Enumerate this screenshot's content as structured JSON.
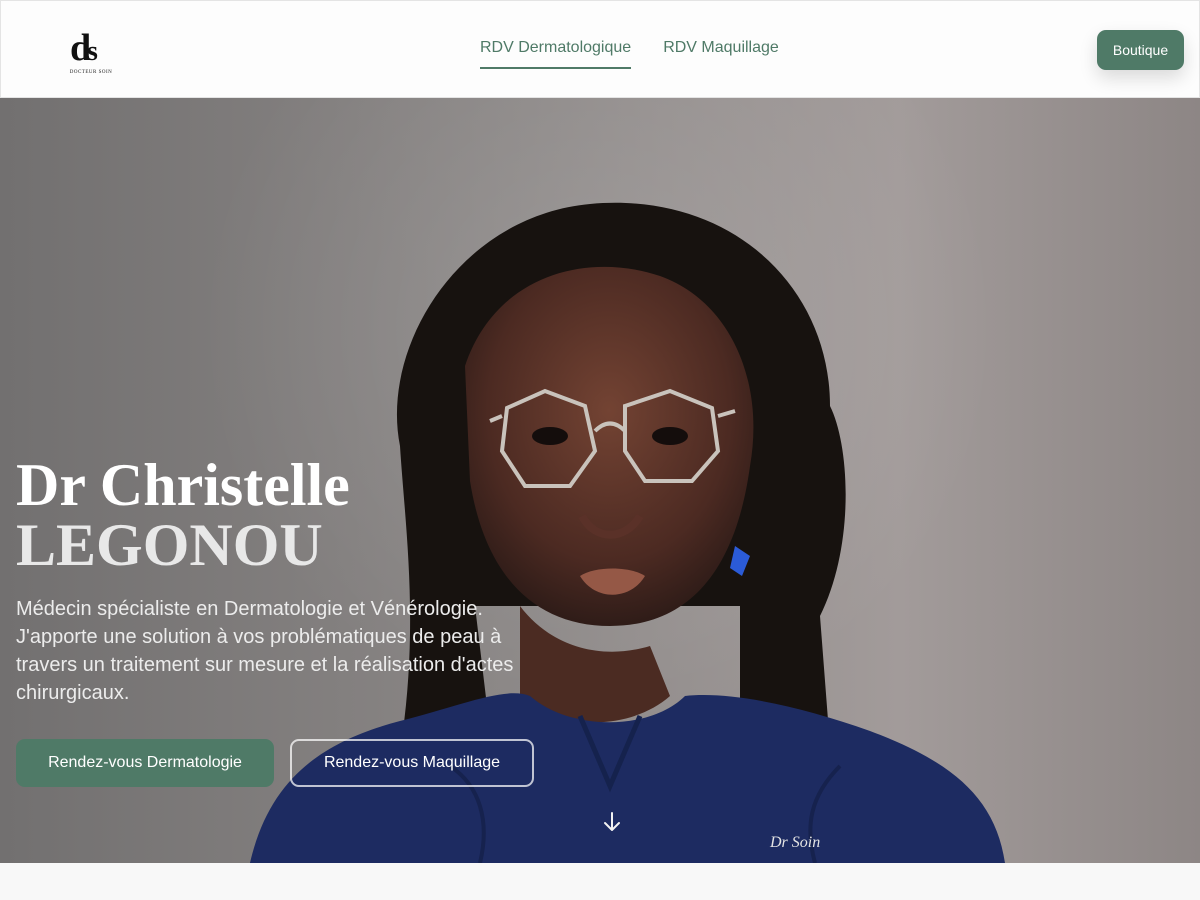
{
  "header": {
    "logo_text": "DOCTEUR SOIN",
    "nav": [
      {
        "label": "RDV Dermatologique",
        "active": true
      },
      {
        "label": "RDV Maquillage",
        "active": false
      }
    ],
    "shop_label": "Boutique"
  },
  "hero": {
    "first_name": "Dr Christelle",
    "last_name": "LEGONOU",
    "description": "Médecin spécialiste en Dermatologie et Vénérologie. J'apporte une solution à vos problématiques de peau à travers un traitement sur mesure et la réalisation d'actes chirurgicaux.",
    "primary_button": "Rendez-vous Dermatologie",
    "secondary_button": "Rendez-vous Maquillage",
    "scrubs_signature": "Dr Soin",
    "icons": [
      "logo-mark",
      "arrow-down-icon"
    ]
  },
  "colors": {
    "accent": "#4f7a67",
    "header_bg": "#fdfdfd",
    "hero_bg": "#8c8887",
    "text_light": "#ffffff"
  }
}
